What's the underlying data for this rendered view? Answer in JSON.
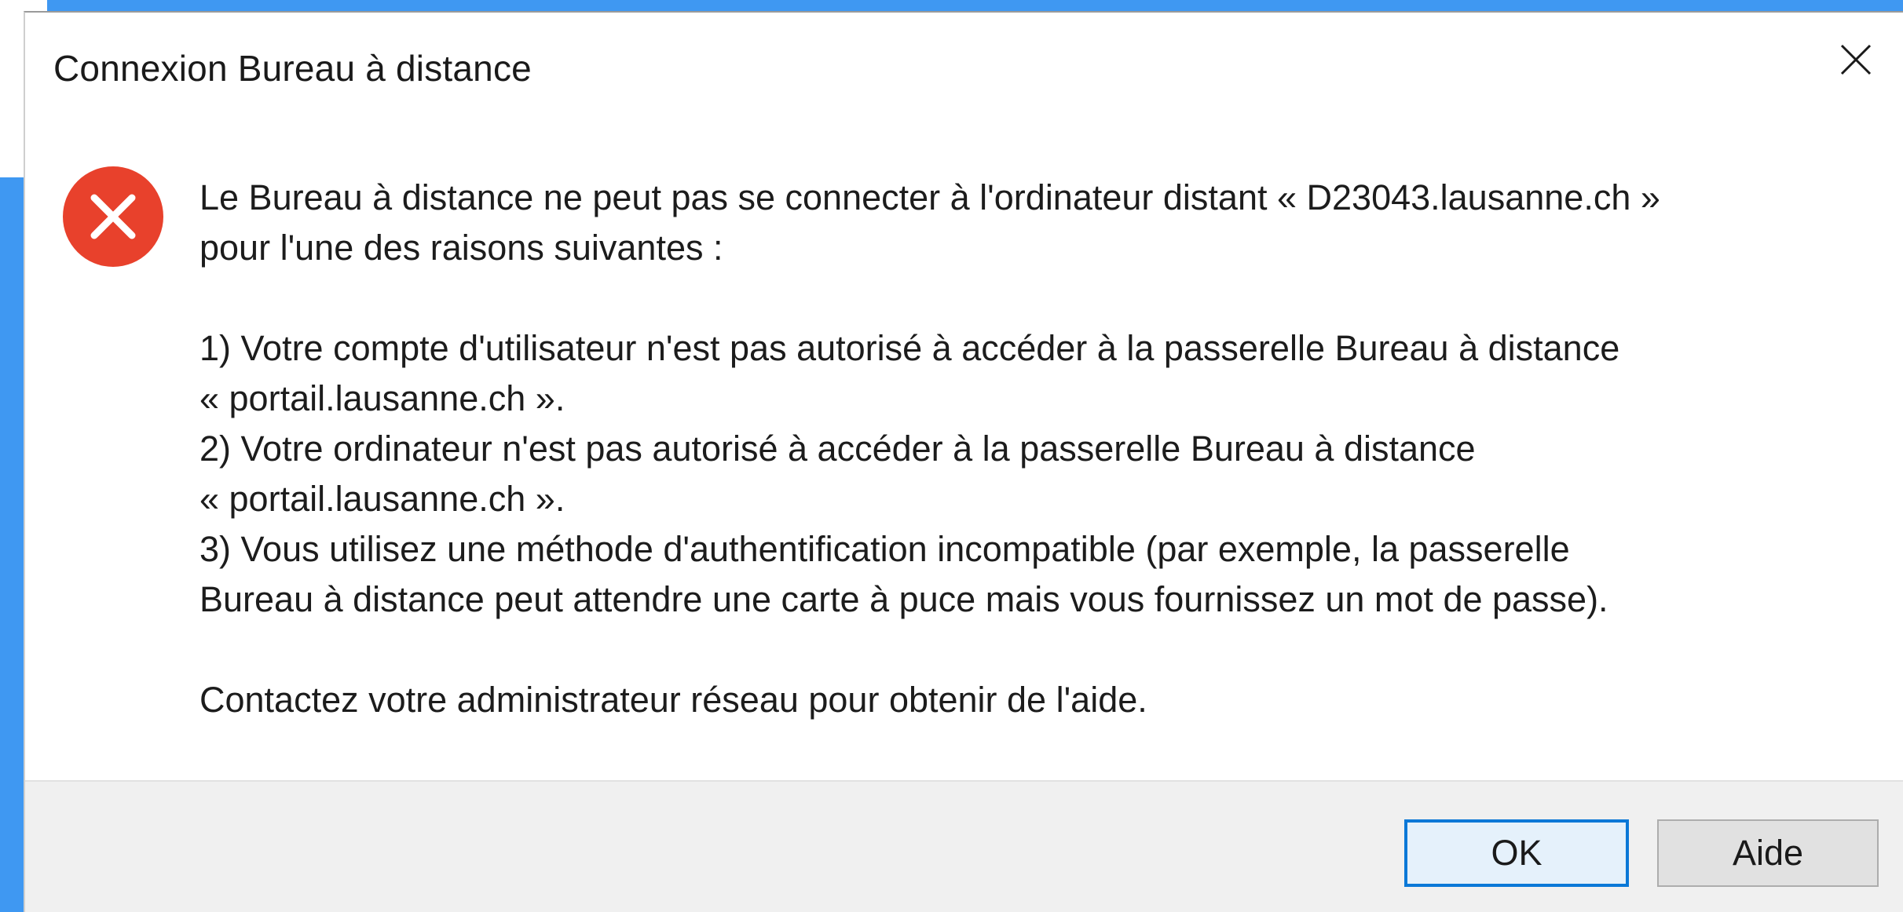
{
  "window": {
    "title": "Connexion Bureau à distance",
    "close_icon": "close-icon"
  },
  "dialog": {
    "icon": "error-icon",
    "icon_color": "#e8412c",
    "message_intro_line1": "Le Bureau à distance ne peut pas se connecter à l'ordinateur distant « D23043.lausanne.ch »",
    "message_intro_line2": "pour l'une des raisons suivantes :",
    "reasons": [
      {
        "line1": "1) Votre compte d'utilisateur n'est pas autorisé à accéder à la passerelle Bureau à distance",
        "line2": "« portail.lausanne.ch »."
      },
      {
        "line1": "2) Votre ordinateur n'est pas autorisé à accéder à la passerelle Bureau à distance",
        "line2": "« portail.lausanne.ch »."
      },
      {
        "line1": "3) Vous utilisez une méthode d'authentification incompatible (par exemple, la passerelle",
        "line2": "Bureau à distance peut attendre une carte à puce mais vous fournissez un mot de passe)."
      }
    ],
    "contact": "Contactez votre administrateur réseau pour obtenir de l'aide."
  },
  "buttons": {
    "ok_label": "OK",
    "help_label": "Aide",
    "focus_color": "#0a78d7"
  }
}
